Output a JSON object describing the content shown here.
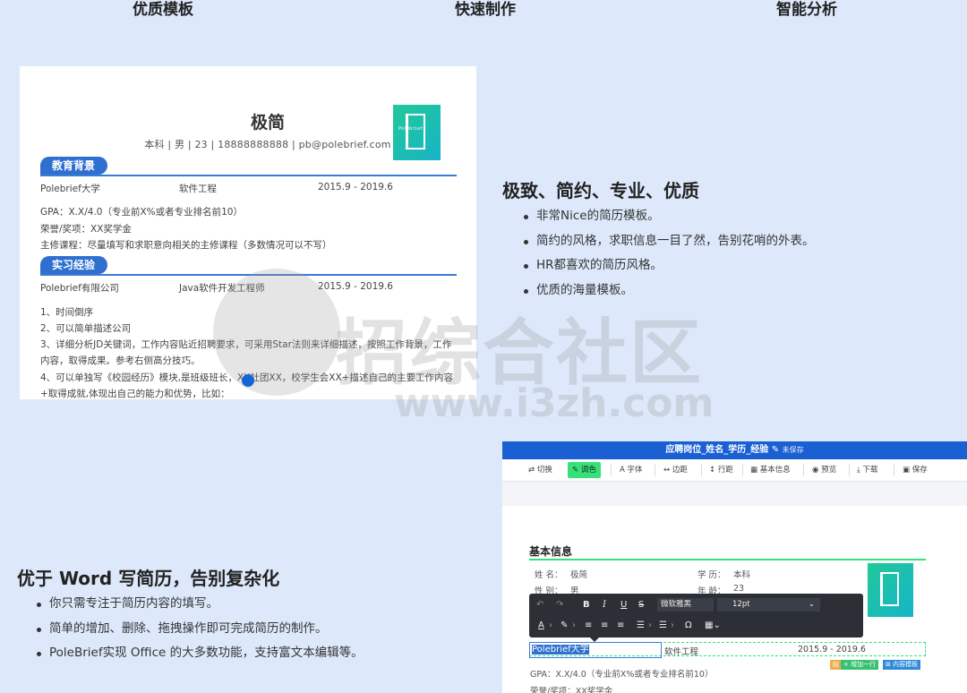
{
  "tabs": [
    "优质模板",
    "快速制作",
    "智能分析"
  ],
  "resume": {
    "name": "极简",
    "meta": "本科 | 男 | 23 | 18888888888 | pb@polebrief.com",
    "photo_brand": "Polebrief",
    "education": {
      "label": "教育背景",
      "school": "Polebrief大学",
      "major": "软件工程",
      "period": "2015.9 - 2019.6",
      "lines": [
        "GPA：X.X/4.0（专业前X%或者专业排名前10）",
        "荣誉/奖项：XX奖学金",
        "主修课程：尽量填写和求职意向相关的主修课程（多数情况可以不写）"
      ]
    },
    "internship": {
      "label": "实习经验",
      "company": "Polebrief有限公司",
      "role": "Java软件开发工程师",
      "period": "2015.9 - 2019.6",
      "lines": [
        "1、时间倒序",
        "2、可以简单描述公司",
        "3、详细分析JD关键词，工作内容贴近招聘要求，可采用Star法则来详细描述，按照工作背景，工作",
        "内容，取得成果。参考右侧高分技巧。",
        "4、可以单独写《校园经历》模块,是班级班长，XX社团XX，校学生会XX+描述自己的主要工作内容",
        "+取得成就,体现出自己的能力和优势，比如："
      ]
    }
  },
  "feature1": {
    "heading": "极致、简约、专业、优质",
    "bullets": [
      "非常Nice的简历模板。",
      "简约的风格，求职信息一目了然，告别花哨的外表。",
      "HR都喜欢的简历风格。",
      "优质的海量模板。"
    ]
  },
  "feature2": {
    "heading": "优于 Word 写简历，告别复杂化",
    "bullets": [
      "你只需专注于简历内容的填写。",
      "简单的增加、删除、拖拽操作即可完成简历的制作。",
      "PoleBrief实现 Office 的大多数功能，支持富文本编辑等。"
    ]
  },
  "watermark": {
    "text": "招综合社区",
    "url": "www.i3zh.com"
  },
  "editor": {
    "title": "应聘岗位_姓名_学历_经验",
    "unsaved": "未保存",
    "toolbar": [
      "⇄ 切换",
      "✎ 调色",
      "A 字体",
      "↔ 边距",
      "↕ 行距",
      "▦ 基本信息",
      "◉ 预览",
      "⤓ 下载",
      "▣ 保存"
    ],
    "section": "基本信息",
    "fields": [
      {
        "label": "姓 名：",
        "value": "极简"
      },
      {
        "label": "学 历：",
        "value": "本科"
      },
      {
        "label": "性 别：",
        "value": "男"
      },
      {
        "label": "年 龄：",
        "value": "23"
      }
    ],
    "rte": {
      "font": "微软雅黑",
      "size": "12pt"
    },
    "row": {
      "school": "Polebrief大学",
      "major": "软件工程",
      "period": "2015.9 - 2019.6"
    },
    "actions": [
      "+ 增加一行",
      "⊞ 内容模板"
    ],
    "lines": [
      "GPA：X.X/4.0（专业前X%或者专业排名前10）",
      "荣誉/奖项：XX奖学金"
    ],
    "colors": {
      "accent": "#1b60d3",
      "green": "#38e07b"
    }
  }
}
